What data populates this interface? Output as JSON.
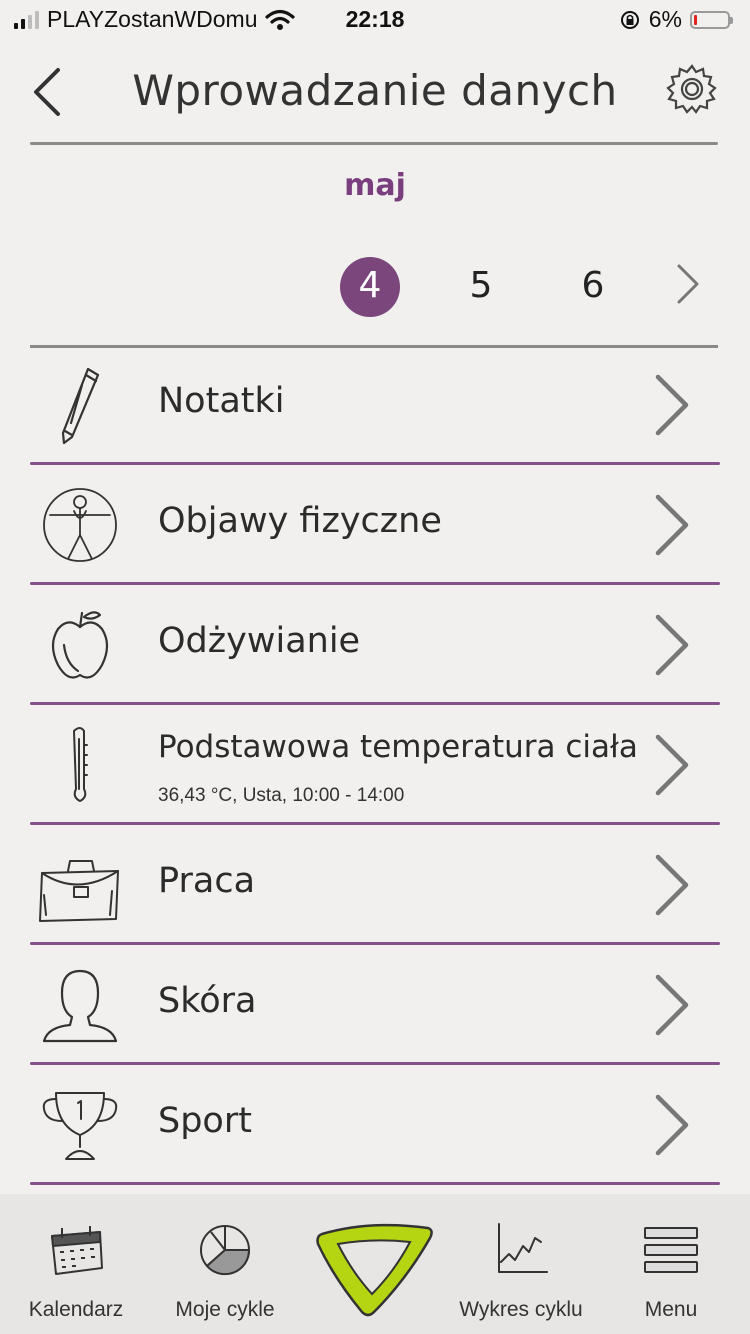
{
  "status_bar": {
    "carrier": "PLAYZostanWDomu",
    "time": "22:18",
    "battery_percent": "6%",
    "battery_level": 0.06,
    "battery_color": "#e22222"
  },
  "header": {
    "title": "Wprowadzanie danych",
    "back_icon": "chevron-left-icon",
    "settings_icon": "gear-icon"
  },
  "date_picker": {
    "month": "maj",
    "days": [
      {
        "label": "4",
        "selected": true
      },
      {
        "label": "5",
        "selected": false
      },
      {
        "label": "6",
        "selected": false
      }
    ],
    "next_icon": "chevron-right-icon",
    "accent_color": "#7a467c"
  },
  "categories": [
    {
      "label": "Notatki",
      "subtitle": "",
      "icon": "pencil-icon"
    },
    {
      "label": "Objawy fizyczne",
      "subtitle": "",
      "icon": "body-figure-icon"
    },
    {
      "label": "Odżywianie",
      "subtitle": "",
      "icon": "apple-icon"
    },
    {
      "label": "Podstawowa temperatura ciała",
      "subtitle": "36,43 °C, Usta, 10:00 - 14:00",
      "icon": "thermometer-icon"
    },
    {
      "label": "Praca",
      "subtitle": "",
      "icon": "briefcase-icon"
    },
    {
      "label": "Skóra",
      "subtitle": "",
      "icon": "person-bust-icon"
    },
    {
      "label": "Sport",
      "subtitle": "",
      "icon": "trophy-icon"
    }
  ],
  "tab_bar": {
    "tabs": [
      {
        "label": "Kalendarz",
        "icon": "calendar-icon"
      },
      {
        "label": "Moje cykle",
        "icon": "pie-chart-icon"
      },
      {
        "label": "",
        "icon": "cycle-ring-icon"
      },
      {
        "label": "Wykres cyklu",
        "icon": "line-graph-icon"
      },
      {
        "label": "Menu",
        "icon": "menu-icon"
      }
    ],
    "center_accent_color": "#b5d412"
  }
}
